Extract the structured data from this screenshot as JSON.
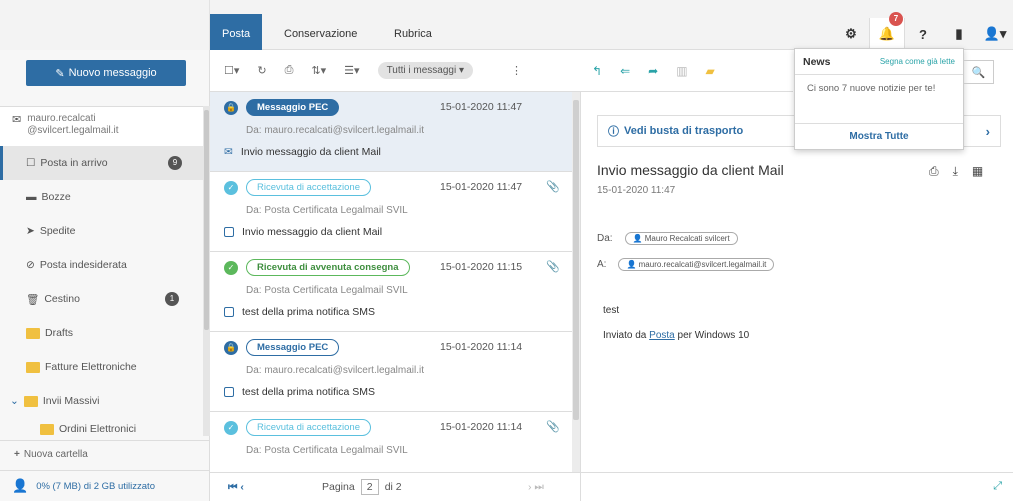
{
  "tabs": [
    "Posta",
    "Conservazione",
    "Rubrica"
  ],
  "header_icons": {
    "notifications_count": "7"
  },
  "sidebar": {
    "new_message": "Nuovo messaggio",
    "account": {
      "line1": "mauro.recalcati",
      "line2": "@svilcert.legalmail.it"
    },
    "folders": [
      {
        "label": "Posta in arrivo",
        "count": "9"
      },
      {
        "label": "Bozze"
      },
      {
        "label": "Spedite"
      },
      {
        "label": "Posta indesiderata"
      },
      {
        "label": "Cestino",
        "count": "1"
      },
      {
        "label": "Drafts"
      },
      {
        "label": "Fatture Elettroniche"
      },
      {
        "label": "Invii Massivi"
      },
      {
        "label": "Ordini Elettronici"
      }
    ],
    "new_folder": "Nuova cartella",
    "quota": "0% (7 MB) di 2 GB utilizzato"
  },
  "list_toolbar": {
    "filter": "Tutti i messaggi"
  },
  "messages": [
    {
      "type": "Messaggio PEC",
      "date": "15-01-2020 11:47",
      "from": "Da: mauro.recalcati@svilcert.legalmail.it",
      "subject": "Invio messaggio da client Mail"
    },
    {
      "type": "Ricevuta di accettazione",
      "date": "15-01-2020 11:47",
      "from": "Da: Posta Certificata Legalmail SVIL",
      "subject": "Invio messaggio da client Mail"
    },
    {
      "type": "Ricevuta di avvenuta consegna",
      "date": "15-01-2020 11:15",
      "from": "Da: Posta Certificata Legalmail SVIL",
      "subject": "test della prima notifica SMS"
    },
    {
      "type": "Messaggio PEC",
      "date": "15-01-2020 11:14",
      "from": "Da: mauro.recalcati@svilcert.legalmail.it",
      "subject": "test della prima notifica SMS"
    },
    {
      "type": "Ricevuta di accettazione",
      "date": "15-01-2020 11:14",
      "from": "Da: Posta Certificata Legalmail SVIL",
      "subject": ""
    }
  ],
  "pager": {
    "label": "Pagina",
    "current": "2",
    "total": "di 2"
  },
  "reader": {
    "vedi_busta": "Vedi busta di trasporto",
    "subject": "Invio messaggio da client Mail",
    "date": "15-01-2020 11:47",
    "from_label": "Da:",
    "from_value": "Mauro Recalcati svilcert",
    "to_label": "A:",
    "to_value": "mauro.recalcati@svilcert.legalmail.it",
    "body1": "test",
    "body2_pre": "Inviato da ",
    "body2_link": "Posta",
    "body2_post": " per Windows 10"
  },
  "news": {
    "title": "News",
    "mark_read": "Segna come già lette",
    "text": "Ci sono 7 nuove notizie per te!",
    "show_all": "Mostra Tutte"
  },
  "colors": {
    "primary": "#2e6da4",
    "teal": "#2aa3a8",
    "success": "#5cb85c",
    "info": "#5bc0de",
    "danger": "#d9534f"
  }
}
